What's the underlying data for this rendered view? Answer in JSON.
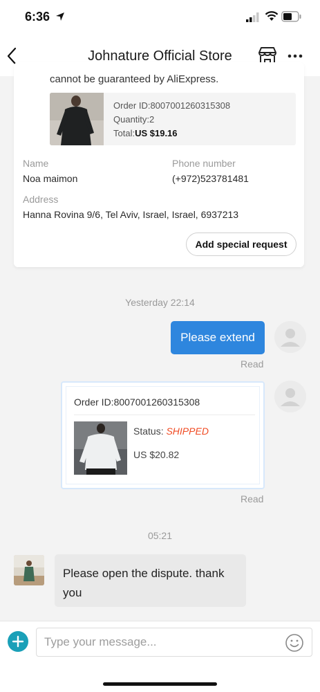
{
  "status_bar": {
    "time": "6:36"
  },
  "header": {
    "title": "Johnature Official Store"
  },
  "order_card": {
    "note": "cannot be guaranteed by AliExpress.",
    "order_id": "Order ID:8007001260315308",
    "quantity": "Quantity:2",
    "total_label": "Total:",
    "total_value": "US $19.16",
    "name_label": "Name",
    "name_value": "Noa  maimon",
    "phone_label": "Phone number",
    "phone_value": "(+972)523781481",
    "address_label": "Address",
    "address_value": "Hanna Rovina 9/6, Tel Aviv, Israel, Israel, 6937213",
    "special_request_label": "Add special request"
  },
  "messages": {
    "timestamp_1": "Yesterday 22:14",
    "outgoing_text": "Please extend",
    "read_label_1": "Read",
    "order_msg": {
      "order_id": "Order ID:8007001260315308",
      "status_label": "Status: ",
      "status_value": "SHIPPED",
      "price": "US $20.82"
    },
    "read_label_2": "Read",
    "timestamp_2": "05:21",
    "incoming_text": "Please open the dispute. thank you"
  },
  "composer": {
    "placeholder": "Type your message..."
  },
  "colors": {
    "accent_blue": "#2e86de",
    "status_orange": "#f04b23",
    "plus_teal": "#1aa0b8"
  }
}
